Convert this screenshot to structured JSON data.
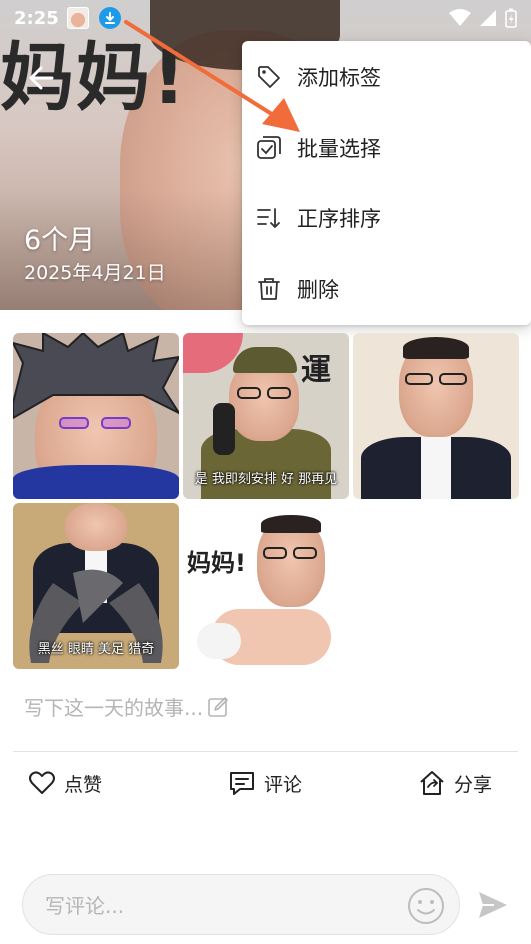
{
  "status_bar": {
    "time": "2:25"
  },
  "cover": {
    "overlay_text": "妈妈!",
    "title": "6个月",
    "date": "2025年4月21日"
  },
  "menu": {
    "items": [
      {
        "label": "添加标签",
        "icon": "tag-icon"
      },
      {
        "label": "批量选择",
        "icon": "checkbox-select-icon"
      },
      {
        "label": "正序排序",
        "icon": "sort-ascending-icon"
      },
      {
        "label": "删除",
        "icon": "trash-icon"
      }
    ]
  },
  "photos": [
    {
      "caption": ""
    },
    {
      "caption": "是 我即刻安排 好 那再见",
      "badge_text": "運"
    },
    {
      "caption": ""
    },
    {
      "caption": "黑丝 眼睛 美足 猎奇"
    },
    {
      "caption": "",
      "overlay_text": "妈妈!"
    }
  ],
  "story": {
    "placeholder": "写下这一天的故事..."
  },
  "actions": {
    "like": "点赞",
    "comment": "评论",
    "share": "分享"
  },
  "comment_bar": {
    "placeholder": "写评论..."
  },
  "colors": {
    "accent_arrow": "#f26b3a",
    "download_badge": "#1e9be8"
  }
}
